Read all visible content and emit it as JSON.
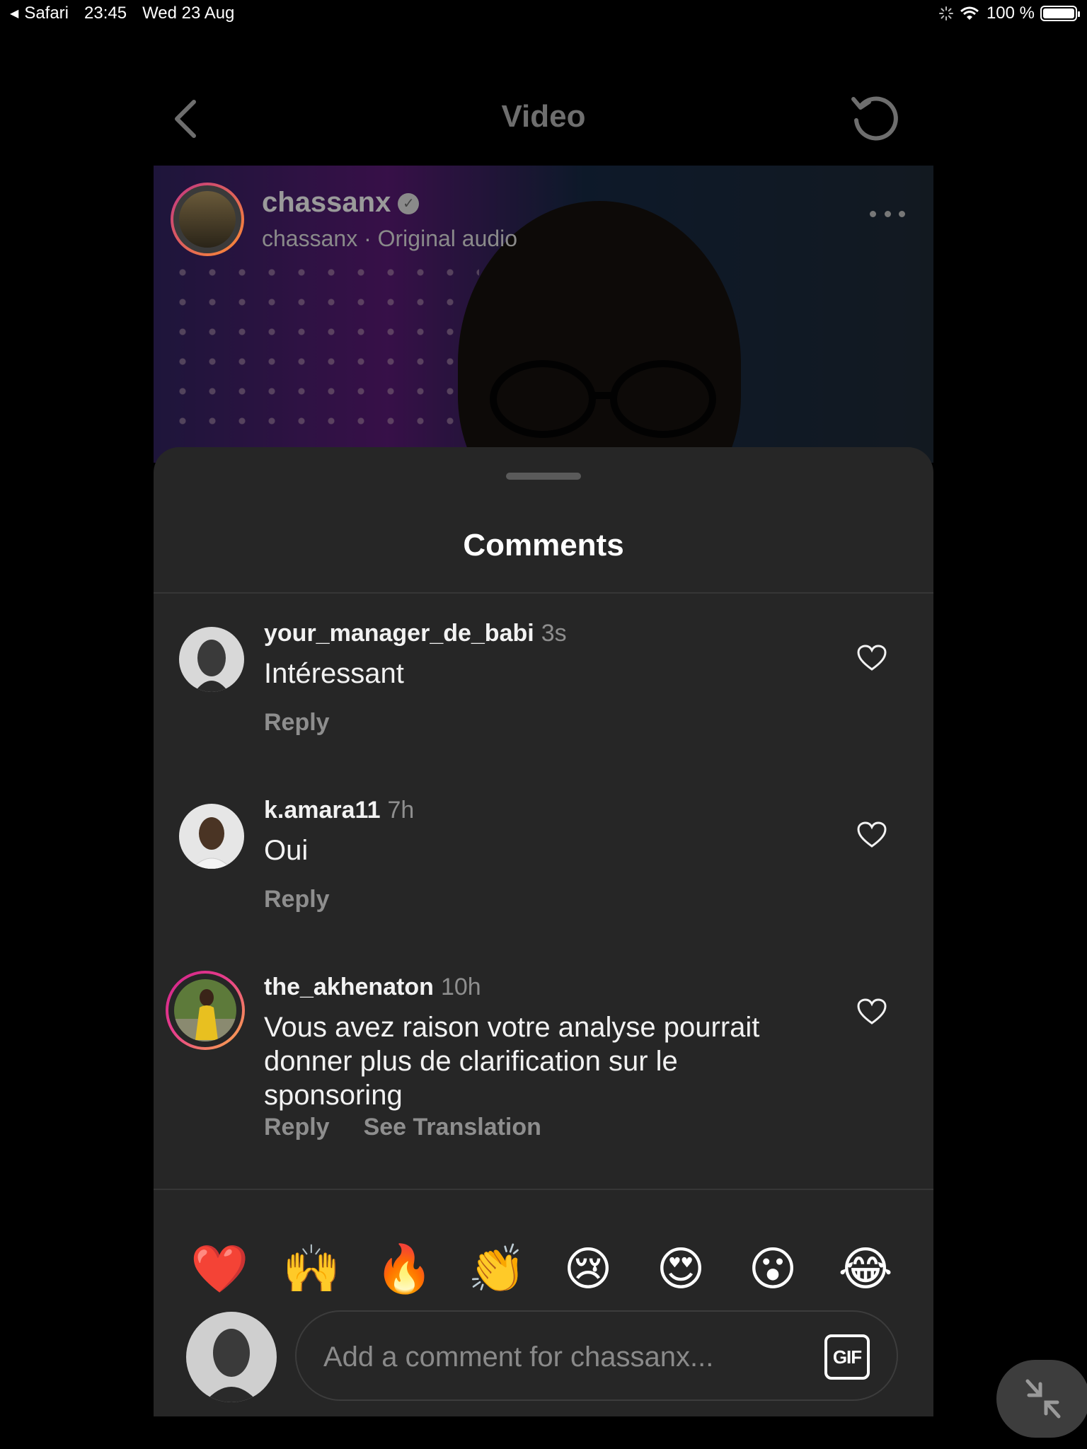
{
  "status_bar": {
    "back_app": "Safari",
    "time": "23:45",
    "date": "Wed 23 Aug",
    "battery": "100 %"
  },
  "header": {
    "title": "Video"
  },
  "video": {
    "username": "chassanx",
    "subtitle": "chassanx · Original audio"
  },
  "comments_sheet": {
    "title": "Comments",
    "comments": [
      {
        "username": "your_manager_de_babi",
        "time": "3s",
        "text": "Intéressant",
        "reply": "Reply"
      },
      {
        "username": "k.amara11",
        "time": "7h",
        "text": "Oui",
        "reply": "Reply"
      },
      {
        "username": "the_akhenaton",
        "time": "10h",
        "text": "Vous avez raison votre analyse pourrait donner plus de clarification sur le sponsoring",
        "reply": "Reply",
        "translate": "See Translation"
      }
    ],
    "emojis": [
      "❤️",
      "🙌",
      "🔥",
      "👏",
      "😢",
      "😍",
      "😮",
      "😂"
    ],
    "input": {
      "placeholder": "Add a comment for chassanx...",
      "gif_label": "GIF"
    }
  },
  "colors": {
    "sheet_bg": "#262626",
    "muted_text": "#8e8e8e",
    "story_ring_start": "#d0208c",
    "story_ring_end": "#fcb045"
  }
}
